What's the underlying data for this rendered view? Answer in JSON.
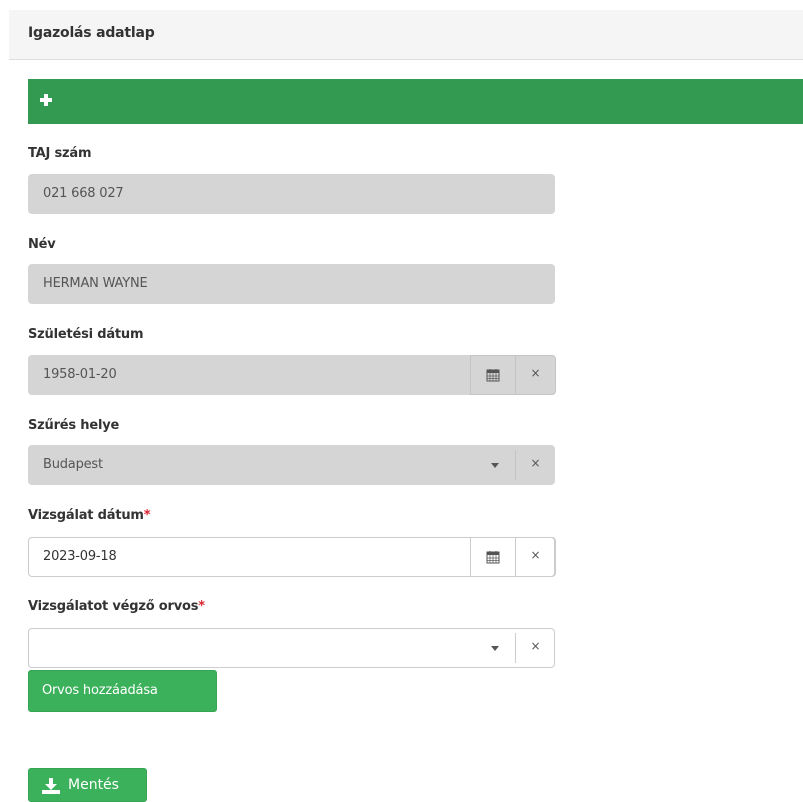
{
  "header": {
    "title": "Igazolás adatlap"
  },
  "toolbar": {
    "add_icon": "plus-icon",
    "color": "#339a52"
  },
  "fields": {
    "taj": {
      "label": "TAJ szám",
      "value": "021 668 027"
    },
    "name": {
      "label": "Név",
      "value": "HERMAN WAYNE"
    },
    "birth_date": {
      "label": "Születési dátum",
      "value": "1958-01-20"
    },
    "screening_place": {
      "label": "Szűrés helye",
      "value": "Budapest"
    },
    "exam_date": {
      "label": "Vizsgálat dátum",
      "required_mark": "*",
      "value": "2023-09-18"
    },
    "doctor": {
      "label": "Vizsgálatot végző orvos",
      "required_mark": "*",
      "value": ""
    }
  },
  "clear_glyph": "×",
  "buttons": {
    "add_doctor": "Orvos hozzáadása",
    "save": "Mentés"
  },
  "colors": {
    "accent": "#3cb15b",
    "required": "#d9232e",
    "disabled_bg": "#d5d5d5"
  }
}
